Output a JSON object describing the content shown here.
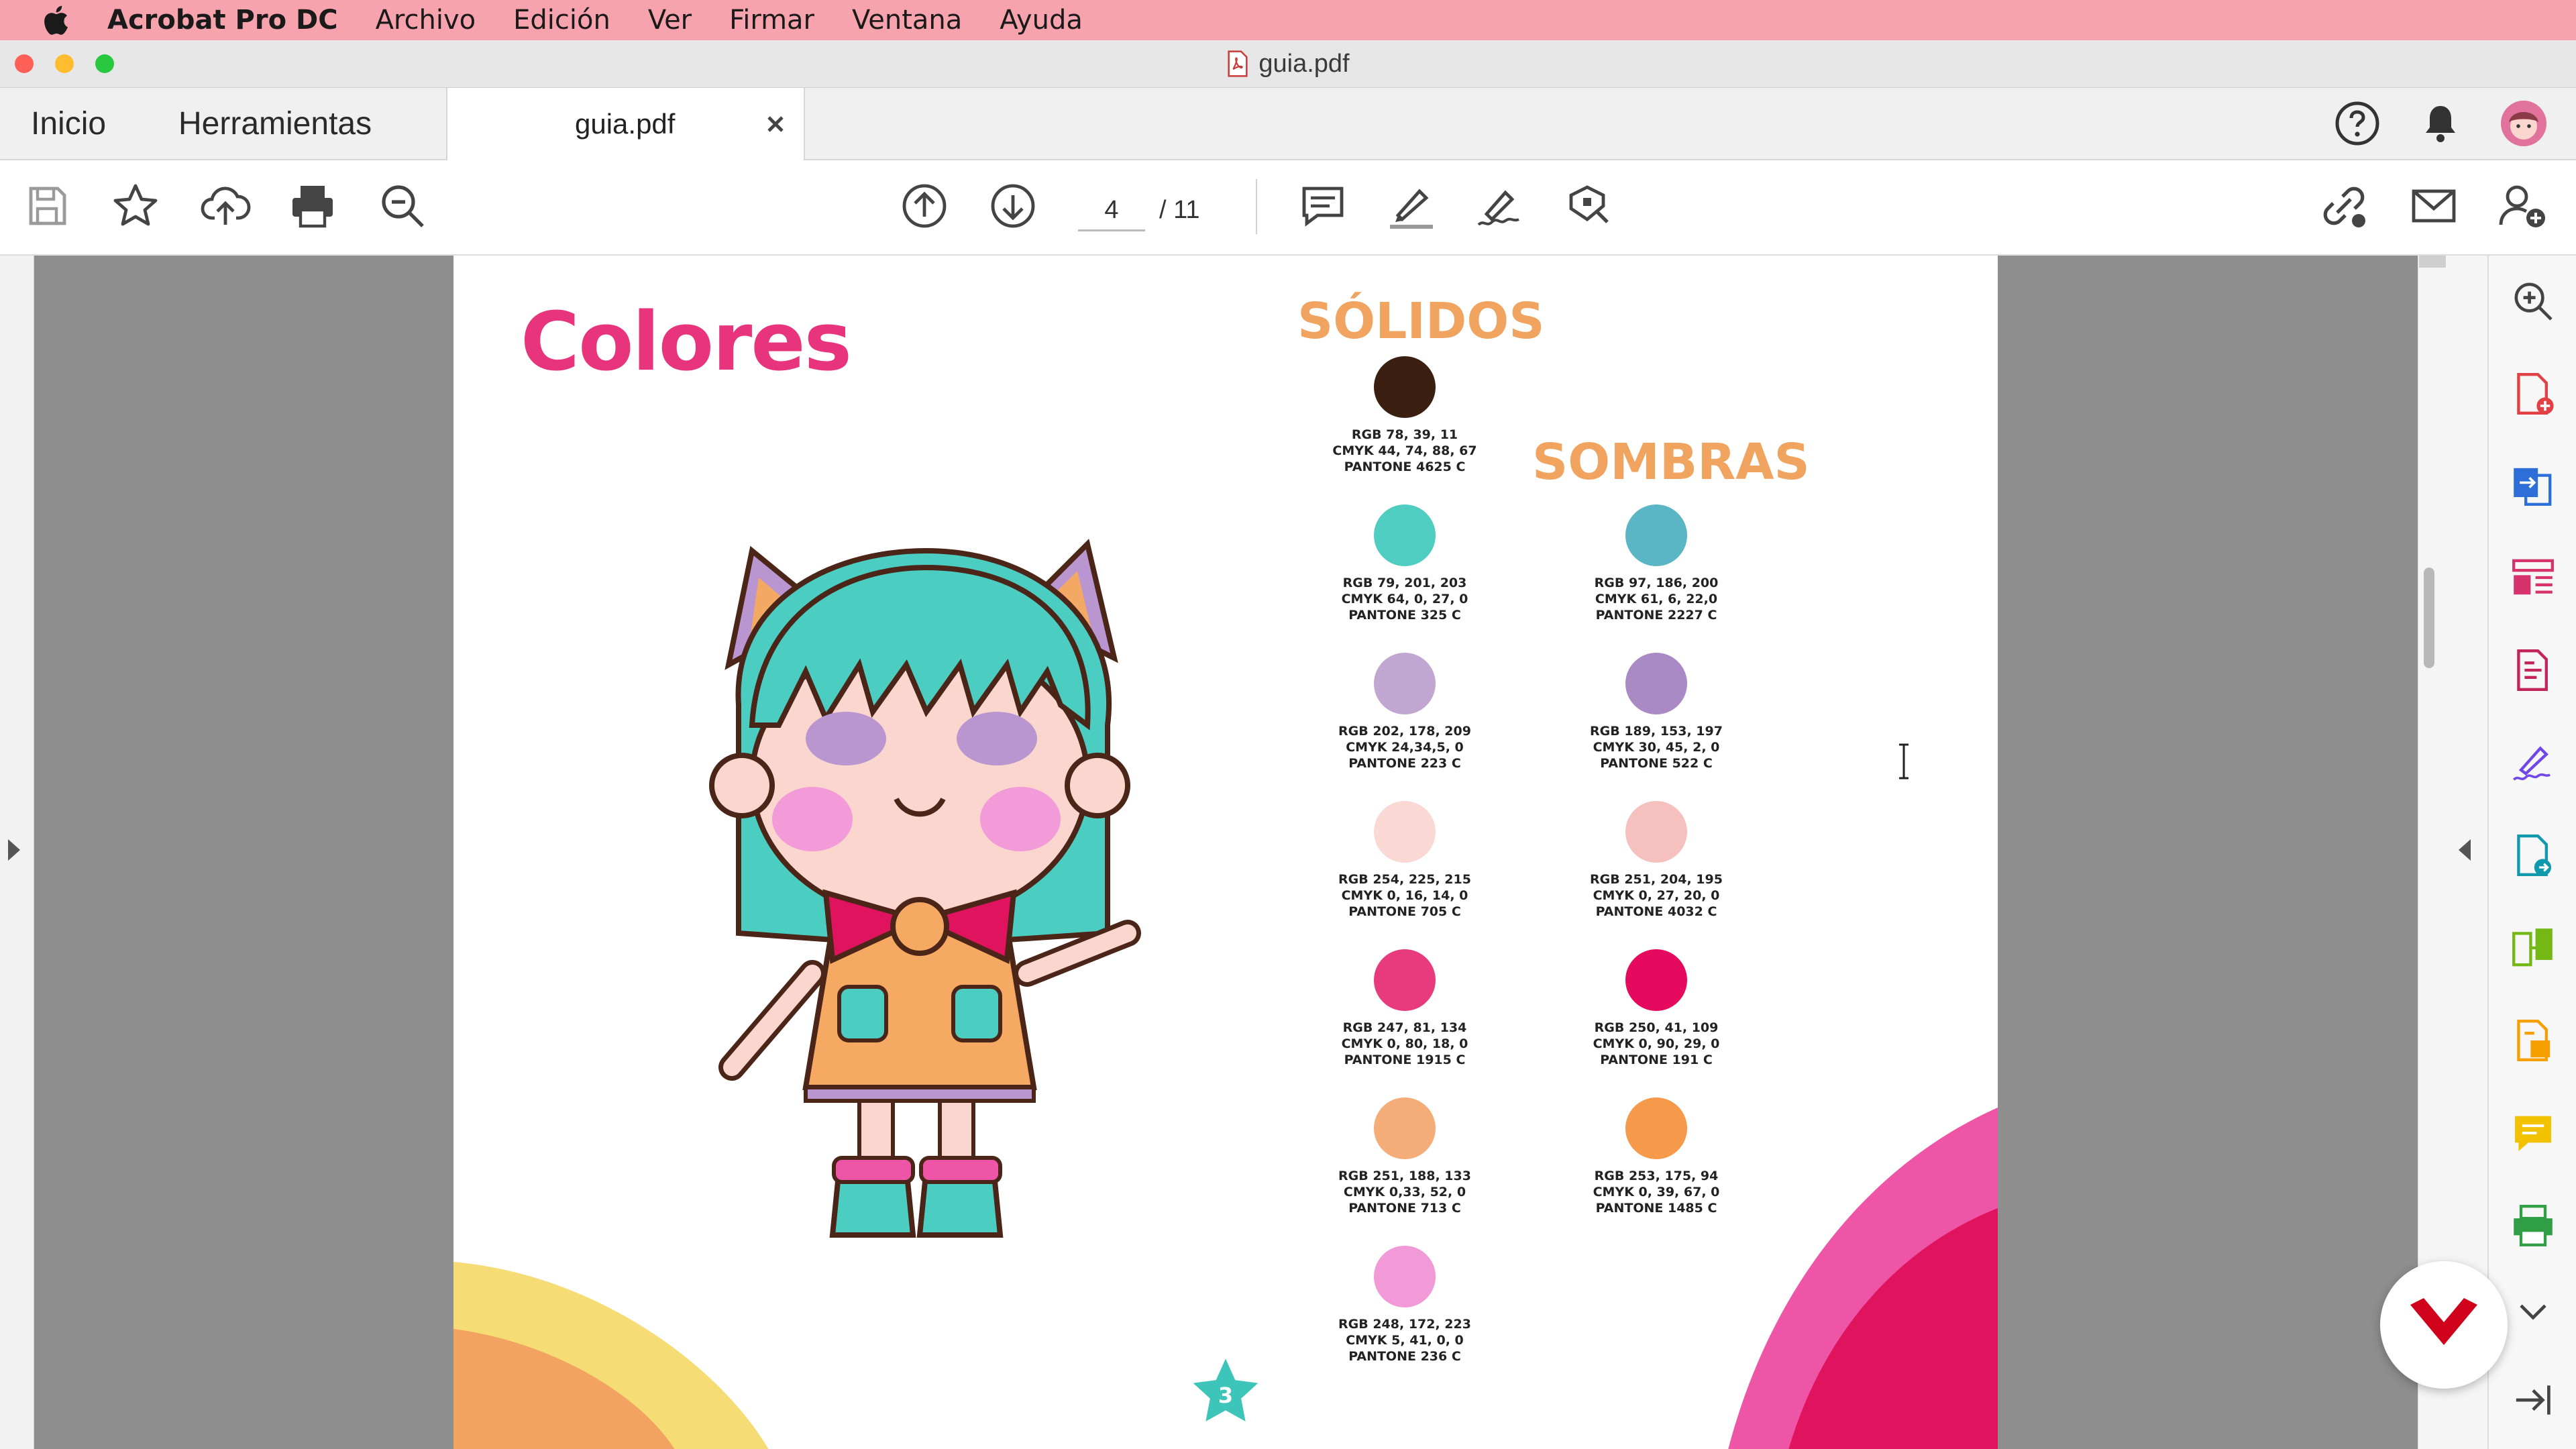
{
  "menubar": {
    "app": "Acrobat Pro DC",
    "items": [
      "Archivo",
      "Edición",
      "Ver",
      "Firmar",
      "Ventana",
      "Ayuda"
    ]
  },
  "window": {
    "title": "guia.pdf"
  },
  "tabs": {
    "home": "Inicio",
    "tools": "Herramientas",
    "document": "guia.pdf"
  },
  "toolbar": {
    "current_page": "4",
    "total_pages": "/ 11"
  },
  "icons": {
    "top_right": [
      "help-icon",
      "bell-icon",
      "avatar"
    ],
    "toolbar_left": [
      "save-icon",
      "star-icon",
      "cloud-upload-icon",
      "print-icon",
      "zoom-out-icon"
    ],
    "toolbar_center": [
      "page-up-icon",
      "page-down-icon",
      "comment-icon",
      "highlight-icon",
      "sign-icon",
      "stamp-icon"
    ],
    "toolbar_right": [
      "share-link-icon",
      "email-icon",
      "add-user-icon"
    ],
    "right_rail": [
      "zoom-icon",
      "create-pdf-icon",
      "export-pdf-icon",
      "organize-pages-icon",
      "edit-pdf-icon",
      "fill-sign-icon",
      "send-sign-icon",
      "compare-icon",
      "scan-icon",
      "comment-tool-icon",
      "print-production-icon",
      "chevron-down-icon",
      "collapse-pane-icon"
    ]
  },
  "page": {
    "title": "Colores",
    "solidos_heading": "SÓLIDOS",
    "sombras_heading": "SOMBRAS",
    "page_number": "3",
    "solidos": [
      {
        "color": "#3b2011",
        "rgb": "RGB 78, 39, 11",
        "cmyk": "CMYK 44, 74, 88, 67",
        "pantone": "PANTONE 4625 C"
      },
      {
        "color": "#4fcdc1",
        "rgb": "RGB 79, 201, 203",
        "cmyk": "CMYK 64, 0, 27, 0",
        "pantone": "PANTONE 325 C"
      },
      {
        "color": "#c2a6d2",
        "rgb": "RGB 202, 178, 209",
        "cmyk": "CMYK 24,34,5, 0",
        "pantone": "PANTONE 223 C"
      },
      {
        "color": "#fad9d4",
        "rgb": "RGB 254, 225, 215",
        "cmyk": "CMYK 0, 16, 14, 0",
        "pantone": "PANTONE 705 C"
      },
      {
        "color": "#e83b7e",
        "rgb": "RGB 247, 81, 134",
        "cmyk": "CMYK 0, 80, 18, 0",
        "pantone": "PANTONE 1915 C"
      },
      {
        "color": "#f4ac78",
        "rgb": "RGB 251, 188, 133",
        "cmyk": "CMYK 0,33, 52, 0",
        "pantone": "PANTONE 713 C"
      },
      {
        "color": "#f29ad8",
        "rgb": "RGB 248, 172, 223",
        "cmyk": "CMYK 5, 41, 0, 0",
        "pantone": "PANTONE 236 C"
      }
    ],
    "sombras": [
      {
        "color": "#5ab6c4",
        "rgb": "RGB 97, 186, 200",
        "cmyk": "CMYK 61, 6, 22,0",
        "pantone": "PANTONE 2227 C"
      },
      {
        "color": "#a98ac4",
        "rgb": "RGB 189, 153, 197",
        "cmyk": "CMYK 30, 45, 2, 0",
        "pantone": "PANTONE 522 C"
      },
      {
        "color": "#f5c0bd",
        "rgb": "RGB 251, 204, 195",
        "cmyk": "CMYK 0, 27, 20, 0",
        "pantone": "PANTONE 4032 C"
      },
      {
        "color": "#e50a5e",
        "rgb": "RGB 250, 41, 109",
        "cmyk": "CMYK 0, 90, 29, 0",
        "pantone": "PANTONE 191 C"
      },
      {
        "color": "#f49a4a",
        "rgb": "RGB 253, 175, 94",
        "cmyk": "CMYK 0, 39, 67, 0",
        "pantone": "PANTONE 1485 C"
      }
    ]
  },
  "colors": {
    "menubar": "#f6a3ad",
    "title_pink": "#e8347c",
    "heading_orange": "#f1a460",
    "teal_star": "#3cc5b8"
  }
}
